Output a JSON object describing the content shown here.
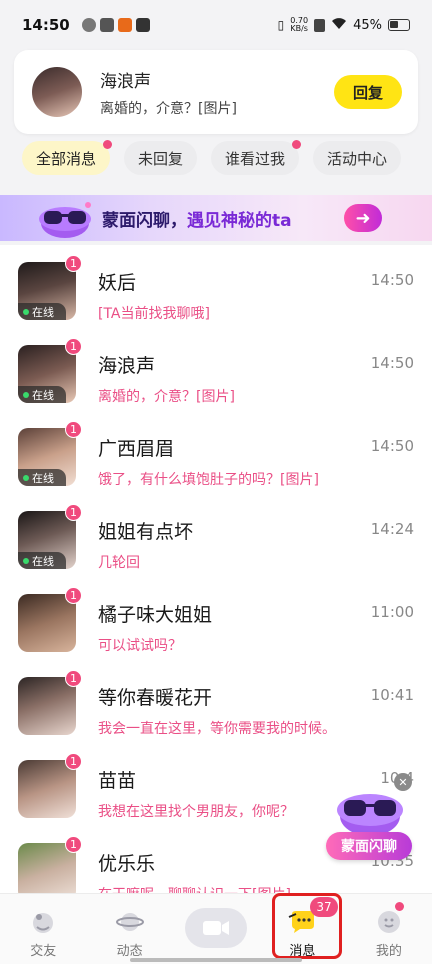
{
  "status_bar": {
    "time": "14:50",
    "net_speed_value": "0.70",
    "net_speed_unit": "KB/s",
    "battery": "45%"
  },
  "notification": {
    "name": "海浪声",
    "message": "离婚的，介意？[图片]",
    "reply_label": "回复"
  },
  "tabs": [
    {
      "label": "全部消息",
      "active": true,
      "dot": true
    },
    {
      "label": "未回复",
      "active": false,
      "dot": false
    },
    {
      "label": "谁看过我",
      "active": false,
      "dot": true
    },
    {
      "label": "活动中心",
      "active": false,
      "dot": false
    }
  ],
  "banner": {
    "text_main": "蒙面闪聊，",
    "text_hl": "遇见神秘的ta",
    "arrow": "➜"
  },
  "messages": [
    {
      "name": "妖后",
      "text": "[TA当前找我聊哦]",
      "time": "14:50",
      "badge": "1",
      "online": true,
      "online_label": "在线"
    },
    {
      "name": "海浪声",
      "text": "离婚的，介意？[图片]",
      "time": "14:50",
      "badge": "1",
      "online": true,
      "online_label": "在线"
    },
    {
      "name": "广西眉眉",
      "text": "饿了，有什么填饱肚子的吗？[图片]",
      "time": "14:50",
      "badge": "1",
      "online": true,
      "online_label": "在线"
    },
    {
      "name": "姐姐有点坏",
      "text": "几轮回",
      "time": "14:24",
      "badge": "1",
      "online": true,
      "online_label": "在线"
    },
    {
      "name": "橘子味大姐姐",
      "text": "可以试试吗？",
      "time": "11:00",
      "badge": "1",
      "online": false,
      "online_label": ""
    },
    {
      "name": "等你春暖花开",
      "text": "我会一直在这里，等你需要我的时候。",
      "time": "10:41",
      "badge": "1",
      "online": false,
      "online_label": ""
    },
    {
      "name": "苗苗",
      "text": "我想在这里找个男朋友，你呢？",
      "time": "10:4",
      "badge": "1",
      "online": false,
      "online_label": ""
    },
    {
      "name": "优乐乐",
      "text": "在干嘛呢，聊聊认识一下[图片]",
      "time": "10:35",
      "badge": "1",
      "online": false,
      "online_label": ""
    }
  ],
  "float_promo": {
    "label": "蒙面闪聊",
    "close": "✕"
  },
  "bottom_nav": [
    {
      "label": "交友",
      "icon": "friends-icon"
    },
    {
      "label": "动态",
      "icon": "planet-icon"
    },
    {
      "label": "",
      "icon": "video-camera-icon"
    },
    {
      "label": "消息",
      "icon": "chat-bubble-icon",
      "badge": "37",
      "active": true
    },
    {
      "label": "我的",
      "icon": "profile-icon",
      "dot": true
    }
  ],
  "colors": {
    "accent_yellow": "#ffe414",
    "accent_pink": "#f04a7d",
    "message_text": "#ea4f86",
    "highlight_red": "#e02020"
  }
}
